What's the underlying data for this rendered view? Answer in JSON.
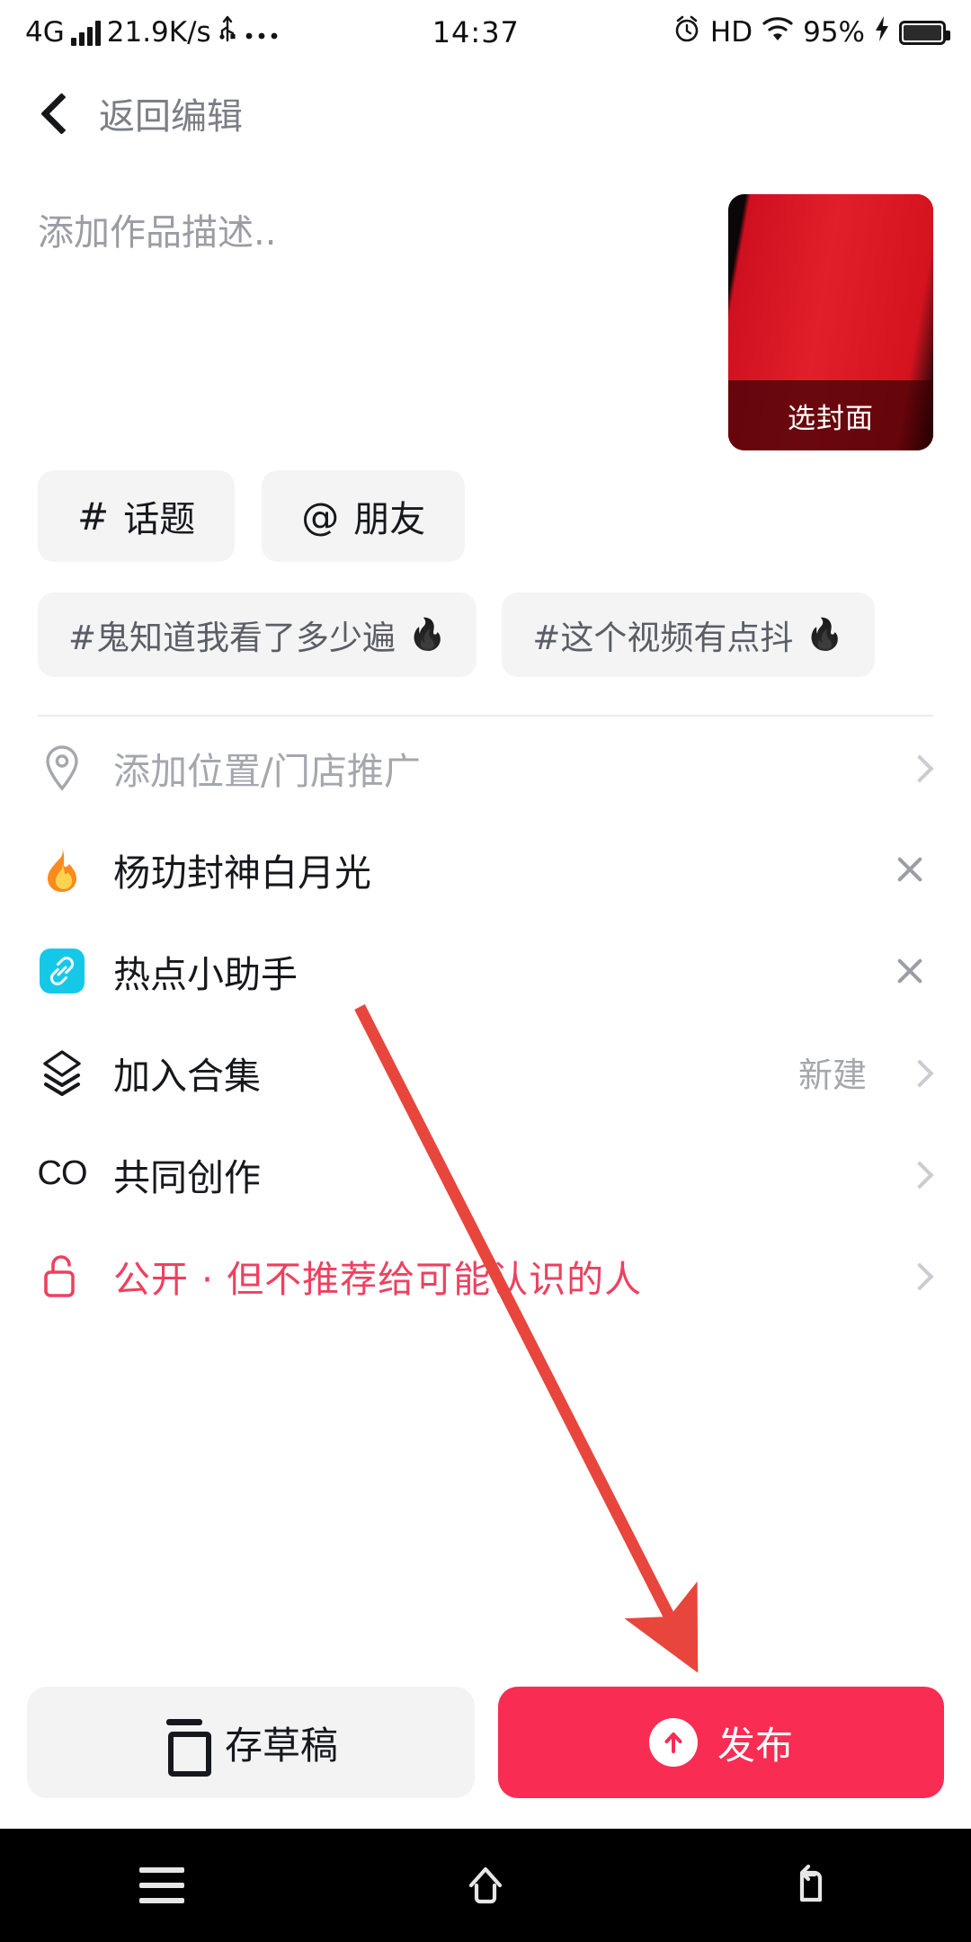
{
  "statusbar": {
    "network": "4G",
    "speed": "21.9K/s",
    "usb_icon": "usb-icon",
    "more_icon": "ellipsis-icon",
    "time": "14:37",
    "alarm_icon": "alarm-icon",
    "hd": "HD",
    "wifi_icon": "wifi-icon",
    "battery_percent": "95%",
    "charging_icon": "bolt-icon"
  },
  "header": {
    "back_icon": "chevron-left-icon",
    "title": "返回编辑"
  },
  "description": {
    "placeholder": "添加作品描述..",
    "value": ""
  },
  "cover": {
    "label": "选封面",
    "accent": "#e11f2a"
  },
  "chips": [
    {
      "symbol": "#",
      "label": "话题",
      "name": "topic"
    },
    {
      "symbol": "@",
      "label": "朋友",
      "name": "friend"
    }
  ],
  "suggested_tags": [
    {
      "text": "#鬼知道我看了多少遍",
      "flame": "🔥"
    },
    {
      "text": "#这个视频有点抖",
      "flame": "🔥"
    }
  ],
  "rows": [
    {
      "icon": "location-pin-icon",
      "label": "添加位置/门店推广",
      "style": "muted",
      "right": "",
      "trailing": "chevron"
    },
    {
      "icon": "flame-icon",
      "label": "杨玏封神白月光",
      "style": "normal",
      "right": "",
      "trailing": "close"
    },
    {
      "icon": "hotspot-assistant-icon",
      "label": "热点小助手",
      "style": "normal",
      "right": "",
      "trailing": "close"
    },
    {
      "icon": "layers-icon",
      "label": "加入合集",
      "style": "normal",
      "right": "新建",
      "trailing": "chevron"
    },
    {
      "icon": "co-create-icon",
      "label": "共同创作",
      "style": "normal",
      "right": "",
      "trailing": "chevron"
    },
    {
      "icon": "unlock-icon",
      "label": "公开 · 但不推荐给可能认识的人",
      "style": "danger",
      "right": "",
      "trailing": "chevron"
    }
  ],
  "bottom": {
    "draft_label": "存草稿",
    "draft_icon": "draft-box-icon",
    "publish_label": "发布",
    "publish_icon": "arrow-up-circle-icon",
    "publish_color": "#f92c53"
  },
  "navbar": {
    "recents_icon": "menu-icon",
    "home_icon": "home-icon",
    "back_icon": "back-arrow-icon"
  },
  "annotation": {
    "arrow_color": "#e8453c",
    "description": "red arrow pointing to publish button"
  }
}
